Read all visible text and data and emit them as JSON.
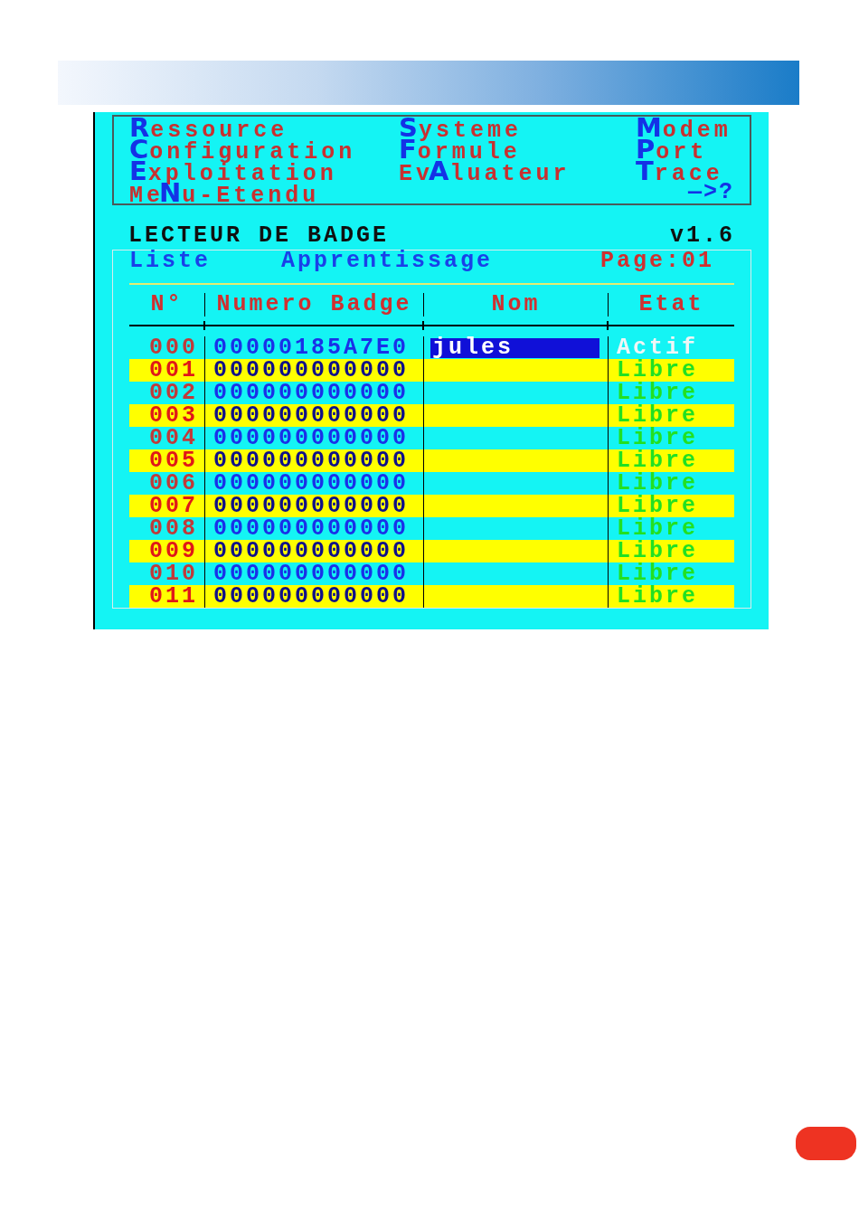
{
  "menu": {
    "rows": [
      [
        {
          "key": "R",
          "rest": "essource"
        },
        {
          "key": "S",
          "rest": "ysteme"
        },
        {
          "key": "M",
          "rest": "odem"
        }
      ],
      [
        {
          "key": "C",
          "rest": "onfiguration"
        },
        {
          "key": "F",
          "rest": "ormule"
        },
        {
          "key": "P",
          "rest": "ort"
        }
      ],
      [
        {
          "key": "E",
          "rest": "xploitation"
        },
        {
          "prefix": "Ev",
          "key": "A",
          "rest": "luateur"
        },
        {
          "key": "T",
          "rest": "race"
        }
      ],
      [
        {
          "prefix": "Me",
          "key": "N",
          "rest": "u-Etendu"
        }
      ]
    ],
    "more": "—>?"
  },
  "screen": {
    "title": "LECTEUR DE BADGE",
    "version": "v1.6"
  },
  "panel": {
    "modes": [
      "Liste",
      "Apprentissage"
    ],
    "page": "Page:01"
  },
  "table": {
    "columns": [
      "N°",
      "Numero Badge",
      "Nom",
      "Etat"
    ],
    "rows": [
      {
        "no": "000",
        "badge": "00000185A7E0",
        "nom": "jules",
        "etat": {
          "text": "Actif",
          "kind": "active"
        },
        "selected": true
      },
      {
        "no": "001",
        "badge": "000000000000",
        "etat": {
          "text": "Libre",
          "kind": "free"
        },
        "selected": false
      },
      {
        "no": "002",
        "badge": "000000000000",
        "etat": {
          "text": "Libre",
          "kind": "free"
        },
        "selected": false
      },
      {
        "no": "003",
        "badge": "000000000000",
        "etat": {
          "text": "Libre",
          "kind": "free"
        },
        "selected": false
      },
      {
        "no": "004",
        "badge": "000000000000",
        "etat": {
          "text": "Libre",
          "kind": "free"
        },
        "selected": false
      },
      {
        "no": "005",
        "badge": "000000000000",
        "etat": {
          "text": "Libre",
          "kind": "free"
        },
        "selected": false
      },
      {
        "no": "006",
        "badge": "000000000000",
        "etat": {
          "text": "Libre",
          "kind": "free"
        },
        "selected": false
      },
      {
        "no": "007",
        "badge": "000000000000",
        "etat": {
          "text": "Libre",
          "kind": "free"
        },
        "selected": false
      },
      {
        "no": "008",
        "badge": "000000000000",
        "etat": {
          "text": "Libre",
          "kind": "free"
        },
        "selected": false
      },
      {
        "no": "009",
        "badge": "000000000000",
        "etat": {
          "text": "Libre",
          "kind": "free"
        },
        "selected": false
      },
      {
        "no": "010",
        "badge": "000000000000",
        "etat": {
          "text": "Libre",
          "kind": "free"
        },
        "selected": false
      },
      {
        "no": "011",
        "badge": "000000000000",
        "etat": {
          "text": "Libre",
          "kind": "free"
        },
        "selected": false
      }
    ]
  }
}
